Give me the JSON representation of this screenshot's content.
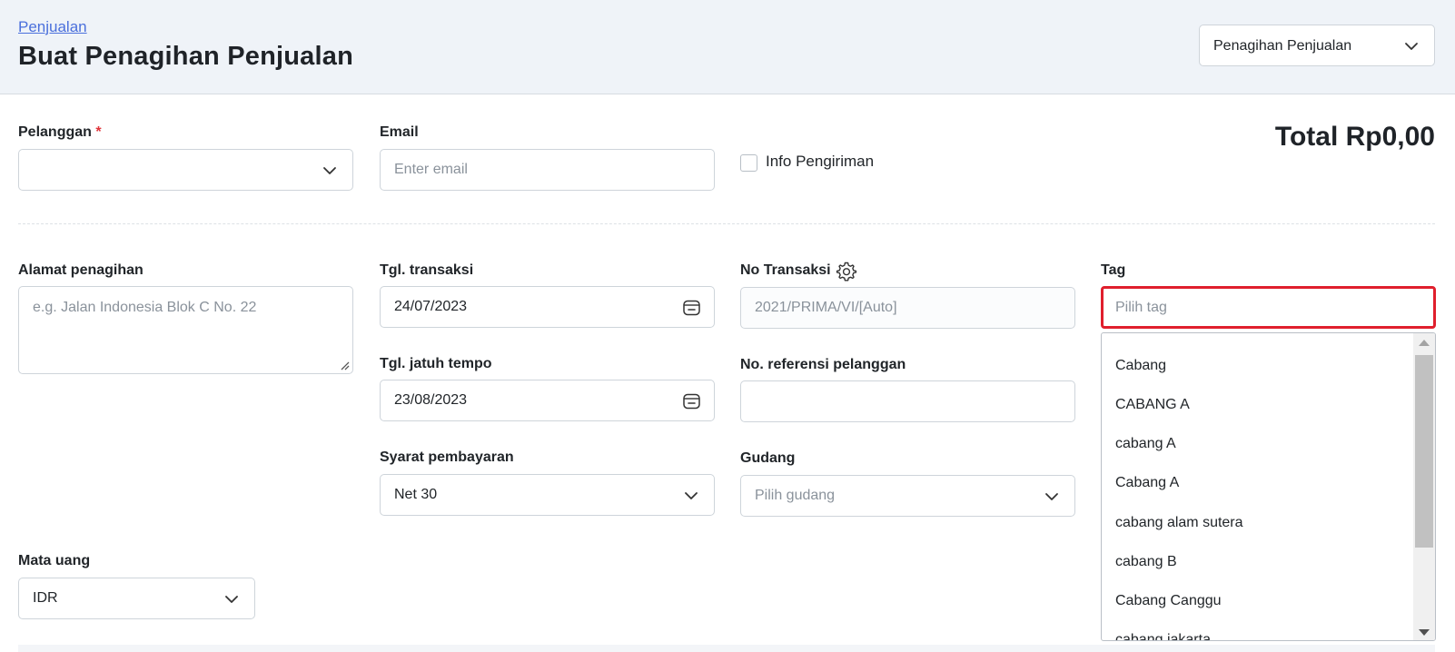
{
  "header": {
    "breadcrumb": "Penjualan",
    "title": "Buat Penagihan Penjualan",
    "type_select": "Penagihan Penjualan"
  },
  "form": {
    "customer": {
      "label": "Pelanggan",
      "required_mark": "*",
      "value": ""
    },
    "email": {
      "label": "Email",
      "placeholder": "Enter email"
    },
    "shipping_info": {
      "label": "Info Pengiriman",
      "checked": false
    },
    "total": "Total Rp0,00",
    "billing_address": {
      "label": "Alamat penagihan",
      "placeholder": "e.g. Jalan Indonesia Blok C No. 22"
    },
    "transaction_date": {
      "label": "Tgl. transaksi",
      "value": "24/07/2023"
    },
    "transaction_no": {
      "label": "No Transaksi",
      "placeholder": "2021/PRIMA/VI/[Auto]"
    },
    "tag": {
      "label": "Tag",
      "placeholder": "Pilih tag"
    },
    "due_date": {
      "label": "Tgl. jatuh tempo",
      "value": "23/08/2023"
    },
    "customer_ref": {
      "label": "No. referensi pelanggan",
      "value": ""
    },
    "payment_terms": {
      "label": "Syarat pembayaran",
      "value": "Net 30"
    },
    "warehouse": {
      "label": "Gudang",
      "placeholder": "Pilih gudang"
    },
    "currency": {
      "label": "Mata uang",
      "value": "IDR"
    }
  },
  "tag_dropdown": {
    "options": [
      "Cabang",
      "CABANG A",
      "cabang A",
      "Cabang A",
      "cabang alam sutera",
      "cabang B",
      "Cabang Canggu",
      "cabang jakarta"
    ]
  },
  "colors": {
    "accent": "#4a6fdc",
    "highlight": "#e01f2d",
    "required": "#e0343a",
    "header_bg": "#eff3f8"
  }
}
